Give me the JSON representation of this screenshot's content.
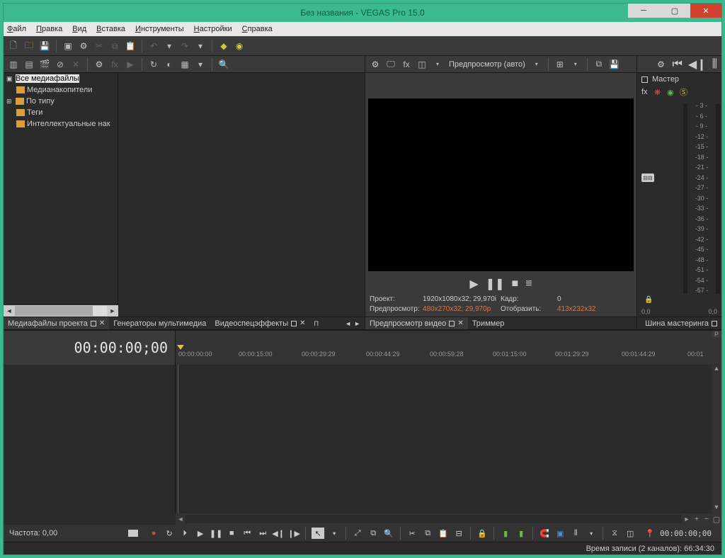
{
  "title": "Без названия - VEGAS Pro 15.0",
  "win": {
    "min": "─",
    "max": "▢",
    "close": "✕"
  },
  "menu": [
    "Файл",
    "Правка",
    "Вид",
    "Вставка",
    "Инструменты",
    "Настройки",
    "Справка"
  ],
  "tree": {
    "root": "Все медиафайлы",
    "items": [
      "Медианакопители",
      "По типу",
      "Теги",
      "Интеллектуальные нак"
    ]
  },
  "left_tabs": {
    "t1": "Медиафайлы проекта",
    "t2": "Генераторы мультимедиа",
    "t3": "Видеоспецэффекты"
  },
  "preview": {
    "quality": "Предпросмотр (авто)",
    "status": {
      "proj_lbl": "Проект:",
      "proj_val": "1920x1080x32; 29,970i",
      "frame_lbl": "Кадр:",
      "frame_val": "0",
      "prev_lbl": "Предпросмотр:",
      "prev_val": "480x270x32; 29,970p",
      "disp_lbl": "Отобразить:",
      "disp_val": "413x232x32"
    },
    "tabs": {
      "t1": "Предпросмотр видео",
      "t2": "Триммер"
    }
  },
  "master": {
    "title": "Мастер",
    "scale": [
      "- 3 -",
      "- 6 -",
      "- 9 -",
      "-12 -",
      "-15 -",
      "-18 -",
      "-21 -",
      "-24 -",
      "-27 -",
      "-30 -",
      "-33 -",
      "-36 -",
      "-39 -",
      "-42 -",
      "-45 -",
      "-48 -",
      "-51 -",
      "-54 -",
      "-57 -"
    ],
    "foot_l": "0,0",
    "foot_r": "0,0",
    "tab": "Шина мастеринга"
  },
  "timeline": {
    "tc": "00:00:00;00",
    "ruler": [
      "00:00:00:00",
      "00:00:15:00",
      "00:00:29:29",
      "00:00:44:29",
      "00:00:59:28",
      "00:01:15:00",
      "00:01:29:29",
      "00:01:44:29",
      "00:01"
    ],
    "rate_lbl": "Частота:",
    "rate_val": "0,00",
    "tc_end": " 00:00:00;00"
  },
  "status": "Время записи (2 каналов): 66:34:30"
}
